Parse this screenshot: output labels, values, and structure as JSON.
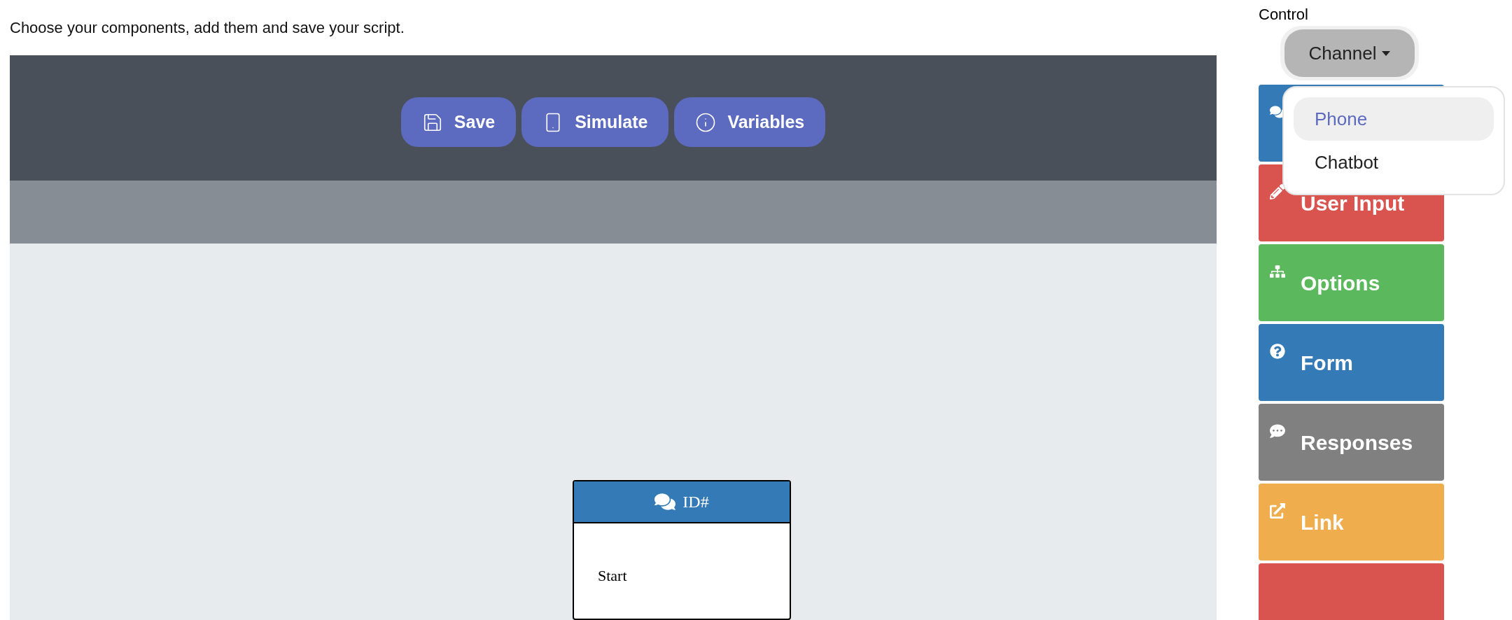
{
  "instructions": "Choose your components, add them and save your script.",
  "toolbar": {
    "buttons": [
      {
        "kind": "save",
        "label": "Save"
      },
      {
        "kind": "simulate",
        "label": "Simulate"
      },
      {
        "kind": "variables",
        "label": "Variables"
      }
    ]
  },
  "canvas": {
    "nodes": [
      {
        "title": "ID#",
        "text": "Start"
      }
    ]
  },
  "control": {
    "title": "Control",
    "channel": {
      "label": "Channel",
      "expanded": true,
      "options": [
        {
          "label": "Phone",
          "selected": true
        },
        {
          "label": "Chatbot",
          "selected": false
        }
      ]
    },
    "components": [
      {
        "kind": "message",
        "color": "#337ab7"
      },
      {
        "kind": "input",
        "label": "User Input",
        "color": "#d9534f"
      },
      {
        "kind": "options",
        "label": "Options",
        "color": "#5cb85c"
      },
      {
        "kind": "form",
        "label": "Form",
        "color": "#337ab7"
      },
      {
        "kind": "responses",
        "label": "Responses",
        "color": "#808080"
      },
      {
        "kind": "link",
        "label": "Link",
        "color": "#f0ad4e"
      },
      {
        "kind": "more",
        "color": "#d9534f"
      }
    ]
  }
}
